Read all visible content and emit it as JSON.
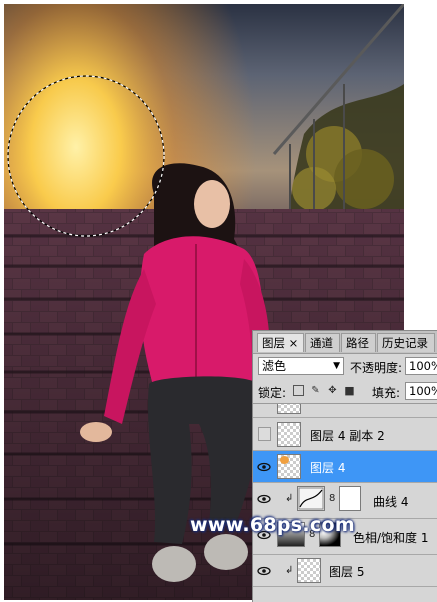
{
  "panel": {
    "tabs": [
      {
        "label": "图层",
        "close": "×",
        "active": true
      },
      {
        "label": "通道",
        "active": false
      },
      {
        "label": "路径",
        "active": false
      },
      {
        "label": "历史记录",
        "active": false
      }
    ],
    "blend_mode": "滤色",
    "opacity_label": "不透明度:",
    "opacity_value": "100%",
    "lock_label": "锁定:",
    "fill_label": "填充:",
    "fill_value": "100%",
    "layers": [
      {
        "name": "",
        "visible": false,
        "selected": false,
        "kind": "partial"
      },
      {
        "name": "图层 4 副本 2",
        "visible": false,
        "selected": false,
        "kind": "pixel"
      },
      {
        "name": "图层 4",
        "visible": true,
        "selected": true,
        "kind": "pixel"
      },
      {
        "name": "曲线 4",
        "visible": true,
        "selected": false,
        "kind": "curves",
        "clipped": true
      },
      {
        "name": "色相/饱和度 1",
        "visible": true,
        "selected": false,
        "kind": "huesat"
      },
      {
        "name": "图层 5",
        "visible": true,
        "selected": false,
        "kind": "pixel",
        "clipped": true
      }
    ]
  },
  "watermark": "www.68ps.com",
  "colors": {
    "selected_layer": "#3e96f6",
    "panel_bg": "#d6d6d6",
    "jacket": "#d81a6a"
  }
}
